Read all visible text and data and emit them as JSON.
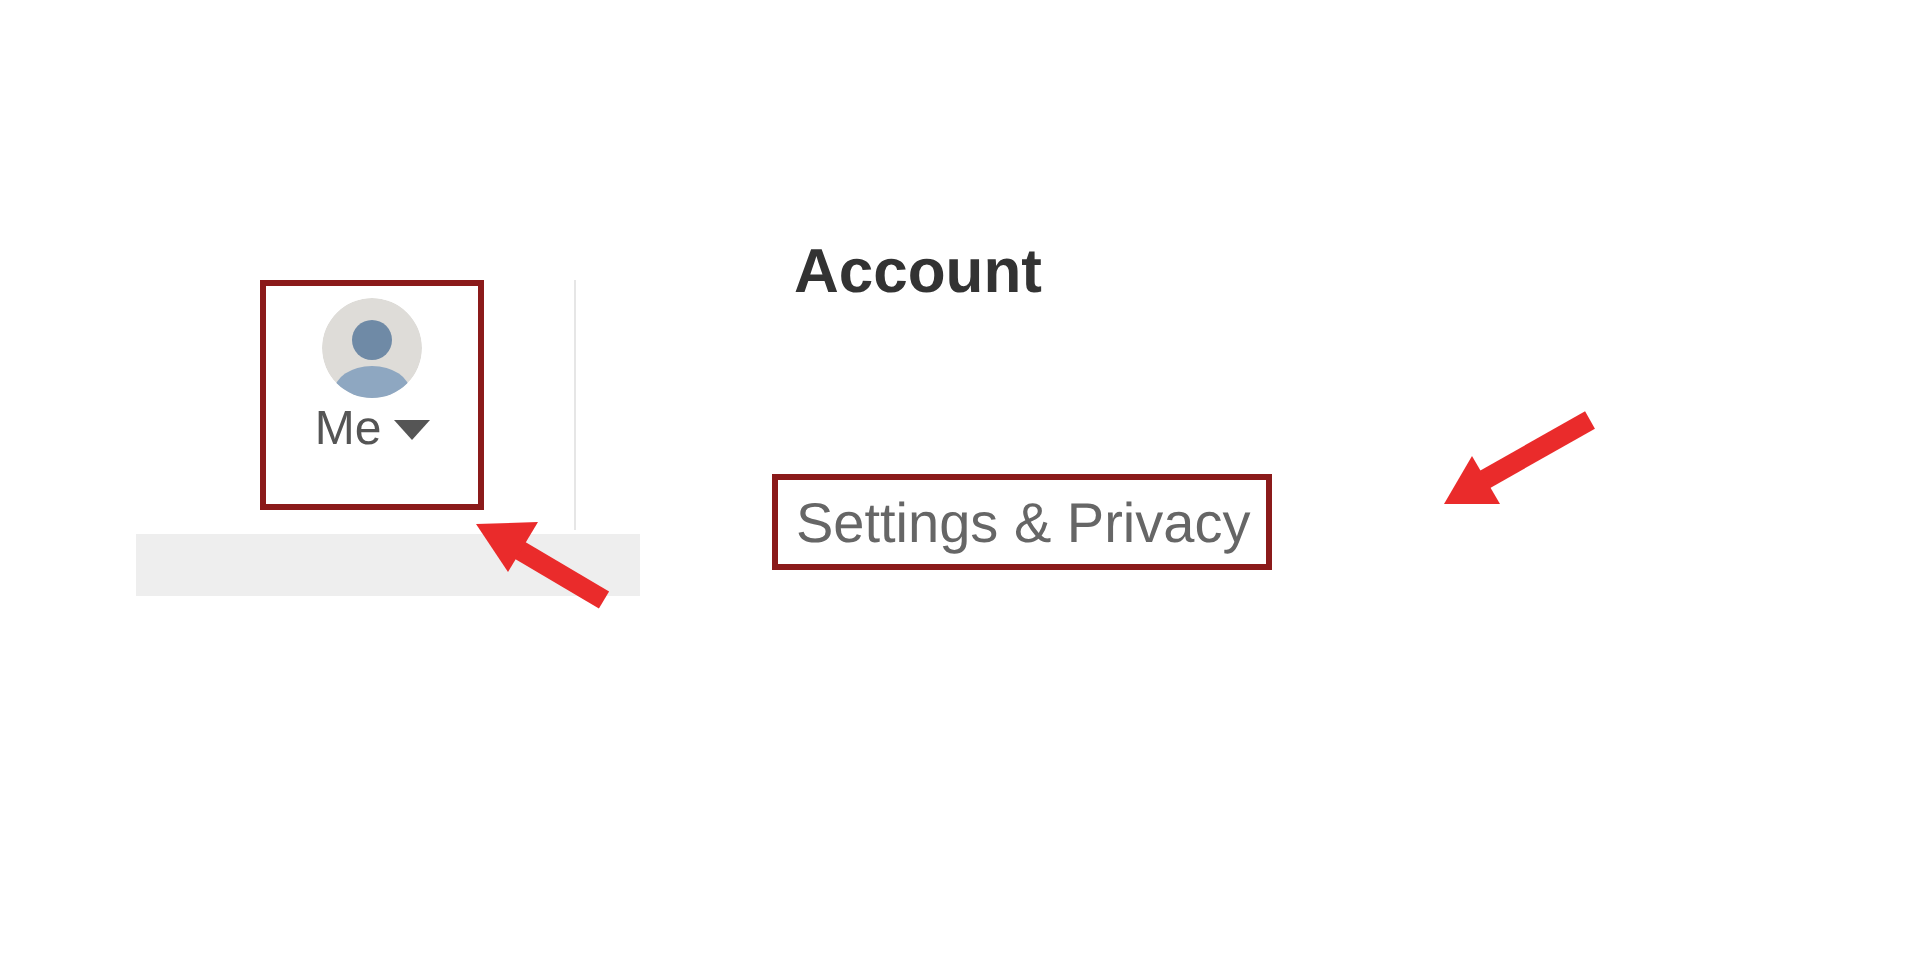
{
  "nav": {
    "label": "Me"
  },
  "menu": {
    "heading": "Account",
    "items": [
      {
        "label": "Settings & Privacy"
      }
    ]
  }
}
